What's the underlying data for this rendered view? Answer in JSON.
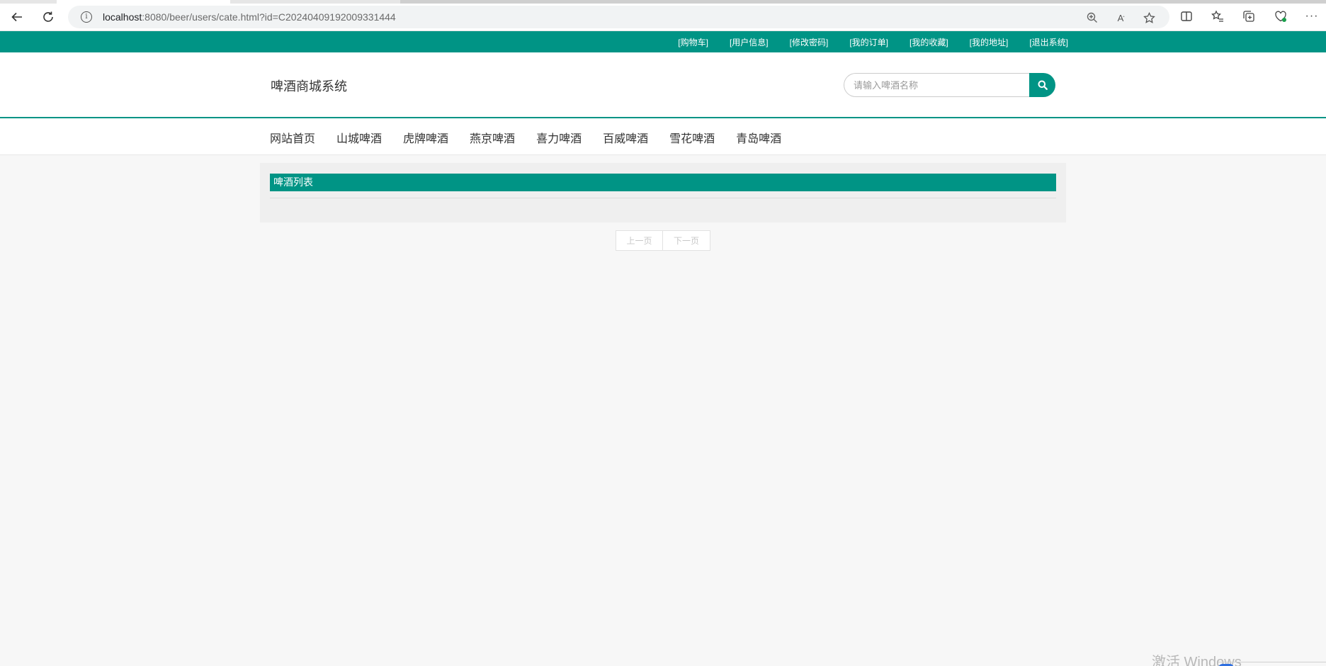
{
  "browser": {
    "url_host": "localhost",
    "url_rest": ":8080/beer/users/cate.html?id=C20240409192009331444"
  },
  "topbar": {
    "links": [
      "[购物车]",
      "[用户信息]",
      "[修改密码]",
      "[我的订单]",
      "[我的收藏]",
      "[我的地址]",
      "[退出系统]"
    ]
  },
  "header": {
    "site_title": "啤酒商城系统",
    "search_placeholder": "请输入啤酒名称"
  },
  "nav": {
    "items": [
      "网站首页",
      "山城啤酒",
      "虎牌啤酒",
      "燕京啤酒",
      "喜力啤酒",
      "百威啤酒",
      "雪花啤酒",
      "青岛啤酒"
    ]
  },
  "main": {
    "panel_title": "啤酒列表"
  },
  "pager": {
    "prev": "上一页",
    "next": "下一页"
  },
  "watermark": "激活 Windows",
  "colors": {
    "brand": "#009485",
    "page_bg": "#f7f7f7"
  }
}
